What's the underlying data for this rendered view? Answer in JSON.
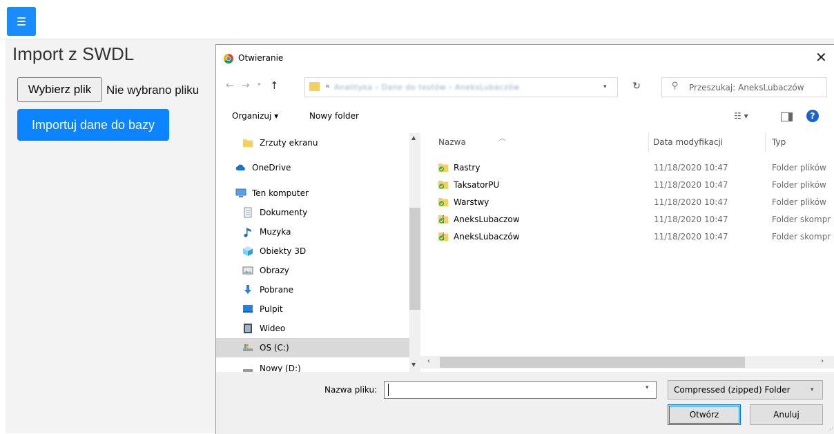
{
  "page": {
    "title": "Import z SWDL",
    "file_button_label": "Wybierz plik",
    "file_status": "Nie wybrano pliku",
    "import_button_label": "Importuj dane do bazy",
    "accent_color": "#0d84ff"
  },
  "dialog": {
    "title": "Otwieranie",
    "close_symbol": "✕",
    "address": {
      "chevron": "«",
      "segments": [
        "Analityka",
        "Dane do testów",
        "AneksLubaczów"
      ],
      "path_text": "Analityka  ›  Dane do testów  ›  AneksLubaczów"
    },
    "search_placeholder": "Przeszukaj: AneksLubaczów",
    "toolbar": {
      "organize_label": "Organizuj ▾",
      "new_folder_label": "Nowy folder",
      "view_label": "☷ ▾",
      "help_label": "?"
    },
    "nav_items": [
      {
        "label": "Zrzuty ekranu",
        "icon": "folder-icon",
        "selected": false
      },
      {
        "label": "OneDrive",
        "icon": "cloud-icon",
        "selected": false
      },
      {
        "label": "Ten komputer",
        "icon": "computer-icon",
        "selected": false
      },
      {
        "label": "Dokumenty",
        "icon": "documents-icon",
        "selected": false
      },
      {
        "label": "Muzyka",
        "icon": "music-icon",
        "selected": false
      },
      {
        "label": "Obiekty 3D",
        "icon": "3d-objects-icon",
        "selected": false
      },
      {
        "label": "Obrazy",
        "icon": "pictures-icon",
        "selected": false
      },
      {
        "label": "Pobrane",
        "icon": "downloads-icon",
        "selected": false
      },
      {
        "label": "Pulpit",
        "icon": "desktop-icon",
        "selected": false
      },
      {
        "label": "Wideo",
        "icon": "video-icon",
        "selected": false
      },
      {
        "label": "OS (C:)",
        "icon": "drive-icon",
        "selected": true
      },
      {
        "label": "Nowy (D:)",
        "icon": "drive-icon",
        "selected": false
      }
    ],
    "columns": [
      "Nazwa",
      "Data modyfikacji",
      "Typ"
    ],
    "files": [
      {
        "name": "Rastry",
        "date": "11/18/2020 10:47",
        "type": "Folder plików",
        "icon": "synced-folder-icon"
      },
      {
        "name": "TaksatorPU",
        "date": "11/18/2020 10:47",
        "type": "Folder plików",
        "icon": "synced-folder-icon"
      },
      {
        "name": "Warstwy",
        "date": "11/18/2020 10:47",
        "type": "Folder plików",
        "icon": "synced-folder-icon"
      },
      {
        "name": "AneksLubaczow",
        "date": "11/18/2020 10:47",
        "type": "Folder skompr",
        "icon": "zip-folder-icon"
      },
      {
        "name": "AneksLubaczów",
        "date": "11/18/2020 10:47",
        "type": "Folder skompr",
        "icon": "zip-folder-icon"
      }
    ],
    "filename_label": "Nazwa pliku:",
    "filename_value": "",
    "file_type_selected": "Compressed (zipped) Folder",
    "open_button_label": "Otwórz",
    "cancel_button_label": "Anuluj",
    "colors": {
      "folder": "#f3cf64",
      "sync_check": "#4caf1e",
      "selected_nav": "#d9d9d9",
      "primary_border": "#0078d7"
    }
  }
}
